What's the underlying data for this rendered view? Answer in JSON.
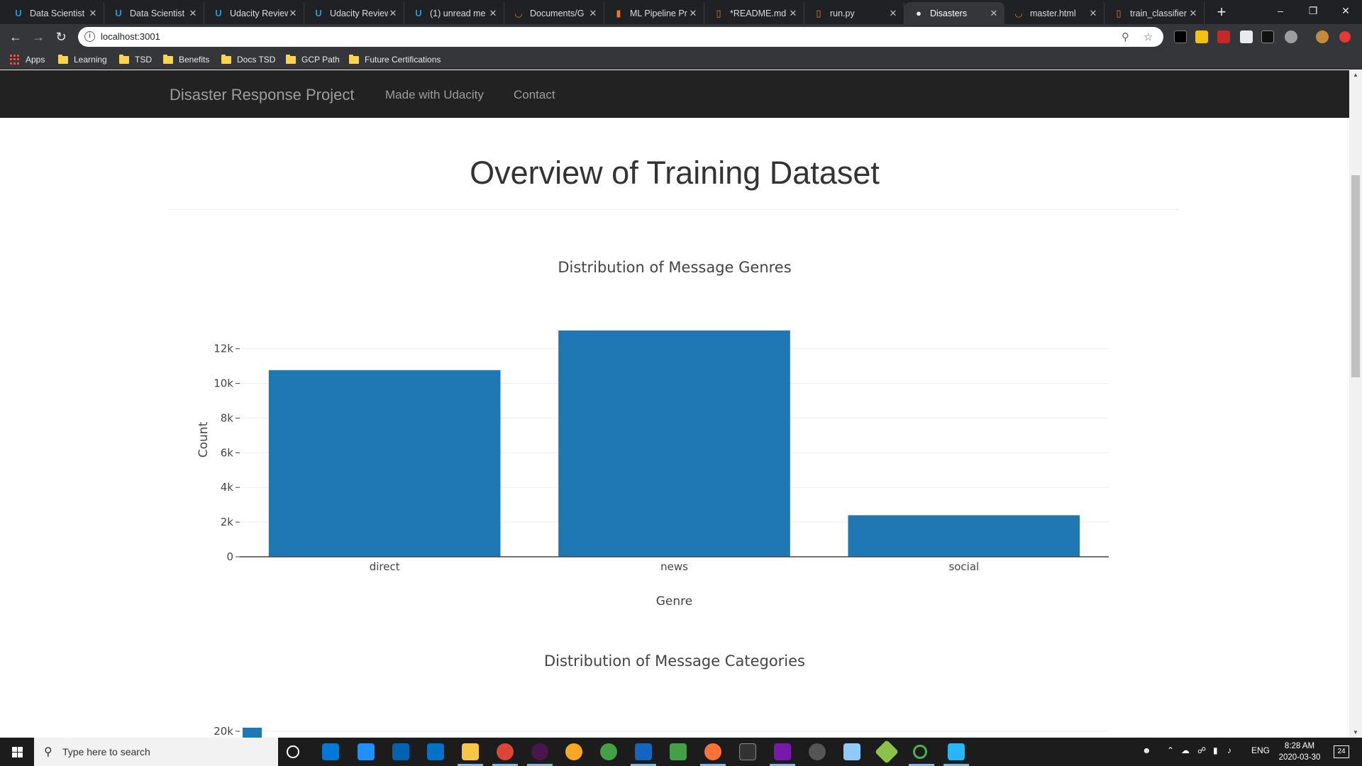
{
  "browser": {
    "tabs": [
      {
        "title": "Data Scientist",
        "icon": "udacity-icon",
        "color": "#1b9be0"
      },
      {
        "title": "Data Scientist",
        "icon": "udacity-icon",
        "color": "#1b9be0"
      },
      {
        "title": "Udacity Review",
        "icon": "udacity-icon",
        "color": "#1b9be0"
      },
      {
        "title": "Udacity Review",
        "icon": "udacity-icon",
        "color": "#1b9be0"
      },
      {
        "title": "(1) unread me",
        "icon": "udacity-icon",
        "color": "#1b9be0"
      },
      {
        "title": "Documents/G",
        "icon": "jupyter-icon",
        "color": "#f37726"
      },
      {
        "title": "ML Pipeline Pr",
        "icon": "notebook-icon",
        "color": "#f37726"
      },
      {
        "title": "*README.md",
        "icon": "file-icon",
        "color": "#f37726"
      },
      {
        "title": "run.py",
        "icon": "file-icon",
        "color": "#f37726"
      },
      {
        "title": "Disasters",
        "icon": "globe-icon",
        "color": "#e8eaed"
      },
      {
        "title": "master.html",
        "icon": "jupyter-icon",
        "color": "#f37726"
      },
      {
        "title": "train_classifier",
        "icon": "file-icon",
        "color": "#f37726"
      }
    ],
    "active_tab": 9,
    "url": "localhost:3001",
    "bookmarks": [
      "Apps",
      "Learning",
      "TSD",
      "Benefits",
      "Docs TSD",
      "GCP Path",
      "Future Certifications"
    ]
  },
  "navbar": {
    "brand": "Disaster Response Project",
    "links": [
      "Made with Udacity",
      "Contact"
    ]
  },
  "page": {
    "title": "Overview of Training Dataset"
  },
  "chart_data": [
    {
      "type": "bar",
      "title": "Distribution of Message Genres",
      "categories": [
        "direct",
        "news",
        "social"
      ],
      "values": [
        10766,
        13054,
        2396
      ],
      "xlabel": "Genre",
      "ylabel": "Count",
      "ylim": [
        0,
        13500
      ],
      "yticks": [
        0,
        2000,
        4000,
        6000,
        8000,
        10000,
        12000
      ],
      "ytick_labels": [
        "0",
        "2k",
        "4k",
        "6k",
        "8k",
        "10k",
        "12k"
      ],
      "grid": true,
      "color": "#1f77b4"
    },
    {
      "type": "bar",
      "title": "Distribution of Message Categories",
      "visible_tick_label": "20k",
      "color": "#1f77b4"
    }
  ],
  "taskbar": {
    "search_placeholder": "Type here to search",
    "language": "ENG",
    "time": "8:28 AM",
    "date": "2020-03-30",
    "notification_count": "24"
  }
}
